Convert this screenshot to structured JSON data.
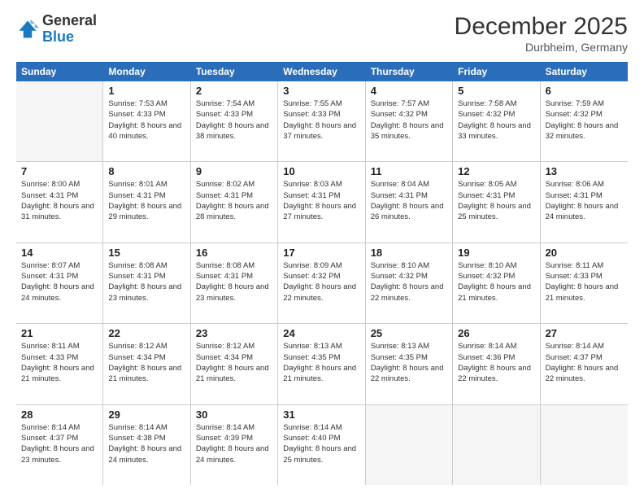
{
  "logo": {
    "general": "General",
    "blue": "Blue"
  },
  "header": {
    "month": "December 2025",
    "location": "Durbheim, Germany"
  },
  "days_of_week": [
    "Sunday",
    "Monday",
    "Tuesday",
    "Wednesday",
    "Thursday",
    "Friday",
    "Saturday"
  ],
  "weeks": [
    [
      {
        "day": "",
        "sunrise": "",
        "sunset": "",
        "daylight": ""
      },
      {
        "day": "1",
        "sunrise": "Sunrise: 7:53 AM",
        "sunset": "Sunset: 4:33 PM",
        "daylight": "Daylight: 8 hours and 40 minutes."
      },
      {
        "day": "2",
        "sunrise": "Sunrise: 7:54 AM",
        "sunset": "Sunset: 4:33 PM",
        "daylight": "Daylight: 8 hours and 38 minutes."
      },
      {
        "day": "3",
        "sunrise": "Sunrise: 7:55 AM",
        "sunset": "Sunset: 4:33 PM",
        "daylight": "Daylight: 8 hours and 37 minutes."
      },
      {
        "day": "4",
        "sunrise": "Sunrise: 7:57 AM",
        "sunset": "Sunset: 4:32 PM",
        "daylight": "Daylight: 8 hours and 35 minutes."
      },
      {
        "day": "5",
        "sunrise": "Sunrise: 7:58 AM",
        "sunset": "Sunset: 4:32 PM",
        "daylight": "Daylight: 8 hours and 33 minutes."
      },
      {
        "day": "6",
        "sunrise": "Sunrise: 7:59 AM",
        "sunset": "Sunset: 4:32 PM",
        "daylight": "Daylight: 8 hours and 32 minutes."
      }
    ],
    [
      {
        "day": "7",
        "sunrise": "Sunrise: 8:00 AM",
        "sunset": "Sunset: 4:31 PM",
        "daylight": "Daylight: 8 hours and 31 minutes."
      },
      {
        "day": "8",
        "sunrise": "Sunrise: 8:01 AM",
        "sunset": "Sunset: 4:31 PM",
        "daylight": "Daylight: 8 hours and 29 minutes."
      },
      {
        "day": "9",
        "sunrise": "Sunrise: 8:02 AM",
        "sunset": "Sunset: 4:31 PM",
        "daylight": "Daylight: 8 hours and 28 minutes."
      },
      {
        "day": "10",
        "sunrise": "Sunrise: 8:03 AM",
        "sunset": "Sunset: 4:31 PM",
        "daylight": "Daylight: 8 hours and 27 minutes."
      },
      {
        "day": "11",
        "sunrise": "Sunrise: 8:04 AM",
        "sunset": "Sunset: 4:31 PM",
        "daylight": "Daylight: 8 hours and 26 minutes."
      },
      {
        "day": "12",
        "sunrise": "Sunrise: 8:05 AM",
        "sunset": "Sunset: 4:31 PM",
        "daylight": "Daylight: 8 hours and 25 minutes."
      },
      {
        "day": "13",
        "sunrise": "Sunrise: 8:06 AM",
        "sunset": "Sunset: 4:31 PM",
        "daylight": "Daylight: 8 hours and 24 minutes."
      }
    ],
    [
      {
        "day": "14",
        "sunrise": "Sunrise: 8:07 AM",
        "sunset": "Sunset: 4:31 PM",
        "daylight": "Daylight: 8 hours and 24 minutes."
      },
      {
        "day": "15",
        "sunrise": "Sunrise: 8:08 AM",
        "sunset": "Sunset: 4:31 PM",
        "daylight": "Daylight: 8 hours and 23 minutes."
      },
      {
        "day": "16",
        "sunrise": "Sunrise: 8:08 AM",
        "sunset": "Sunset: 4:31 PM",
        "daylight": "Daylight: 8 hours and 23 minutes."
      },
      {
        "day": "17",
        "sunrise": "Sunrise: 8:09 AM",
        "sunset": "Sunset: 4:32 PM",
        "daylight": "Daylight: 8 hours and 22 minutes."
      },
      {
        "day": "18",
        "sunrise": "Sunrise: 8:10 AM",
        "sunset": "Sunset: 4:32 PM",
        "daylight": "Daylight: 8 hours and 22 minutes."
      },
      {
        "day": "19",
        "sunrise": "Sunrise: 8:10 AM",
        "sunset": "Sunset: 4:32 PM",
        "daylight": "Daylight: 8 hours and 21 minutes."
      },
      {
        "day": "20",
        "sunrise": "Sunrise: 8:11 AM",
        "sunset": "Sunset: 4:33 PM",
        "daylight": "Daylight: 8 hours and 21 minutes."
      }
    ],
    [
      {
        "day": "21",
        "sunrise": "Sunrise: 8:11 AM",
        "sunset": "Sunset: 4:33 PM",
        "daylight": "Daylight: 8 hours and 21 minutes."
      },
      {
        "day": "22",
        "sunrise": "Sunrise: 8:12 AM",
        "sunset": "Sunset: 4:34 PM",
        "daylight": "Daylight: 8 hours and 21 minutes."
      },
      {
        "day": "23",
        "sunrise": "Sunrise: 8:12 AM",
        "sunset": "Sunset: 4:34 PM",
        "daylight": "Daylight: 8 hours and 21 minutes."
      },
      {
        "day": "24",
        "sunrise": "Sunrise: 8:13 AM",
        "sunset": "Sunset: 4:35 PM",
        "daylight": "Daylight: 8 hours and 21 minutes."
      },
      {
        "day": "25",
        "sunrise": "Sunrise: 8:13 AM",
        "sunset": "Sunset: 4:35 PM",
        "daylight": "Daylight: 8 hours and 22 minutes."
      },
      {
        "day": "26",
        "sunrise": "Sunrise: 8:14 AM",
        "sunset": "Sunset: 4:36 PM",
        "daylight": "Daylight: 8 hours and 22 minutes."
      },
      {
        "day": "27",
        "sunrise": "Sunrise: 8:14 AM",
        "sunset": "Sunset: 4:37 PM",
        "daylight": "Daylight: 8 hours and 22 minutes."
      }
    ],
    [
      {
        "day": "28",
        "sunrise": "Sunrise: 8:14 AM",
        "sunset": "Sunset: 4:37 PM",
        "daylight": "Daylight: 8 hours and 23 minutes."
      },
      {
        "day": "29",
        "sunrise": "Sunrise: 8:14 AM",
        "sunset": "Sunset: 4:38 PM",
        "daylight": "Daylight: 8 hours and 24 minutes."
      },
      {
        "day": "30",
        "sunrise": "Sunrise: 8:14 AM",
        "sunset": "Sunset: 4:39 PM",
        "daylight": "Daylight: 8 hours and 24 minutes."
      },
      {
        "day": "31",
        "sunrise": "Sunrise: 8:14 AM",
        "sunset": "Sunset: 4:40 PM",
        "daylight": "Daylight: 8 hours and 25 minutes."
      },
      {
        "day": "",
        "sunrise": "",
        "sunset": "",
        "daylight": ""
      },
      {
        "day": "",
        "sunrise": "",
        "sunset": "",
        "daylight": ""
      },
      {
        "day": "",
        "sunrise": "",
        "sunset": "",
        "daylight": ""
      }
    ]
  ]
}
